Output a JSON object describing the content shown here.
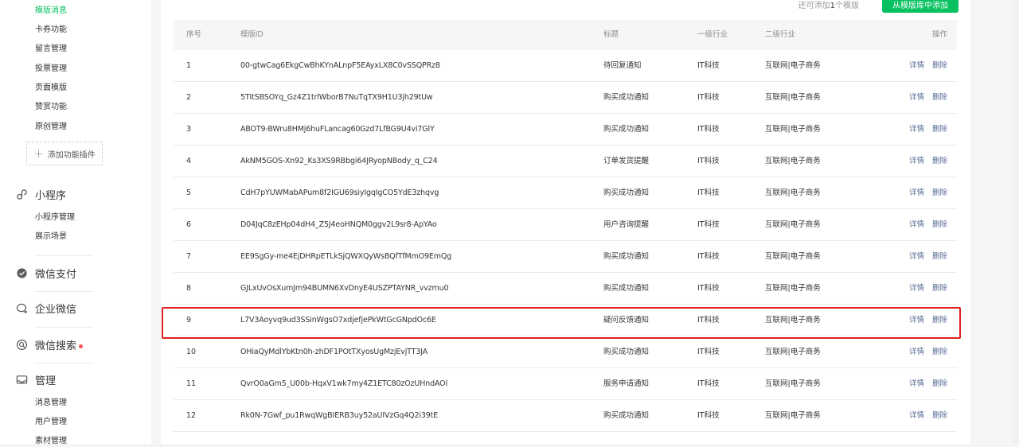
{
  "sidebar": {
    "top_items": [
      {
        "label": "模版消息",
        "active": true
      },
      {
        "label": "卡券功能"
      },
      {
        "label": "留言管理"
      },
      {
        "label": "投票管理"
      },
      {
        "label": "页面模版"
      },
      {
        "label": "赞赏功能"
      },
      {
        "label": "原创管理"
      }
    ],
    "add_plugin_label": "添加功能插件",
    "sections": {
      "miniprogram": {
        "label": "小程序",
        "icon": "link-icon",
        "items": [
          "小程序管理",
          "展示场景"
        ]
      },
      "pay": {
        "label": "微信支付",
        "icon": "wechat-pay-icon"
      },
      "work": {
        "label": "企业微信",
        "icon": "wecom-icon"
      },
      "search": {
        "label": "微信搜索",
        "icon": "search-icon",
        "has_dot": true
      },
      "manage": {
        "label": "管理",
        "icon": "manage-icon",
        "items": [
          "消息管理",
          "用户管理",
          "素材管理"
        ]
      }
    }
  },
  "toolbar": {
    "remaining_prefix": "还可添加",
    "remaining_count": "1",
    "remaining_suffix": "个模版",
    "add_button_label": "从模版库中添加"
  },
  "table": {
    "headers": {
      "index": "序号",
      "id": "模版ID",
      "title": "标题",
      "industry1": "一级行业",
      "industry2": "二级行业",
      "ops": "操作"
    },
    "detail_label": "详情",
    "delete_label": "删除",
    "rows": [
      {
        "index": "1",
        "id": "00-gtwCag6EkgCwBhKYnALnpF5EAyxLX8C0vSSQPRz8",
        "title": "待回复通知",
        "industry1": "IT科技",
        "industry2": "互联网|电子商务"
      },
      {
        "index": "2",
        "id": "5TItSBSOYq_Gz4Z1trlWborB7NuTqTX9H1U3jh29tUw",
        "title": "购买成功通知",
        "industry1": "IT科技",
        "industry2": "互联网|电子商务"
      },
      {
        "index": "3",
        "id": "ABOT9-BWru8HMj6huFLancag60Gzd7LfBG9U4vi7GlY",
        "title": "购买成功通知",
        "industry1": "IT科技",
        "industry2": "互联网|电子商务"
      },
      {
        "index": "4",
        "id": "AkNM5GOS-Xn92_Ks3XS9RBbgi64JRyopNBody_q_C24",
        "title": "订单发货提醒",
        "industry1": "IT科技",
        "industry2": "互联网|电子商务"
      },
      {
        "index": "5",
        "id": "CdH7pYUWMabAPum8f2IGU69siyIgqIgCO5YdE3zhqvg",
        "title": "购买成功通知",
        "industry1": "IT科技",
        "industry2": "互联网|电子商务"
      },
      {
        "index": "6",
        "id": "D04JqC8zEHp04dH4_Z5J4eoHNQM0ggv2L9sr8-ApYAo",
        "title": "用户咨询提醒",
        "industry1": "IT科技",
        "industry2": "互联网|电子商务"
      },
      {
        "index": "7",
        "id": "EE9SgGy-me4EjDHRpETLkSjQWXQyWsBQfTfMmO9EmQg",
        "title": "购买成功通知",
        "industry1": "IT科技",
        "industry2": "互联网|电子商务"
      },
      {
        "index": "8",
        "id": "GJLxUvOsXumJm94BUMN6XvDnyE4USZPTAYNR_vvzmu0",
        "title": "购买成功通知",
        "industry1": "IT科技",
        "industry2": "互联网|电子商务"
      },
      {
        "index": "9",
        "id": "L7V3Aoyvq9ud3SSinWgsO7xdjefjePkWtGcGNpdOc6E",
        "title": "疑问反馈通知",
        "industry1": "IT科技",
        "industry2": "互联网|电子商务"
      },
      {
        "index": "10",
        "id": "OHiaQyMdlYbKtn0h-zhDF1POtTXyosUgMzjEvjTT3JA",
        "title": "购买成功通知",
        "industry1": "IT科技",
        "industry2": "互联网|电子商务"
      },
      {
        "index": "11",
        "id": "QvrO0aGm5_U00b-HqxV1wk7my4Z1ETC80zOzUHndAOI",
        "title": "服务申请通知",
        "industry1": "IT科技",
        "industry2": "互联网|电子商务"
      },
      {
        "index": "12",
        "id": "Rk0N-7Gwf_pu1RwqWgBIERB3uy52aUIVzGq4Q2i39tE",
        "title": "购买成功通知",
        "industry1": "IT科技",
        "industry2": "互联网|电子商务"
      }
    ]
  },
  "colors": {
    "accent": "#07c160",
    "link": "#576b95",
    "highlight": "#e02020"
  }
}
